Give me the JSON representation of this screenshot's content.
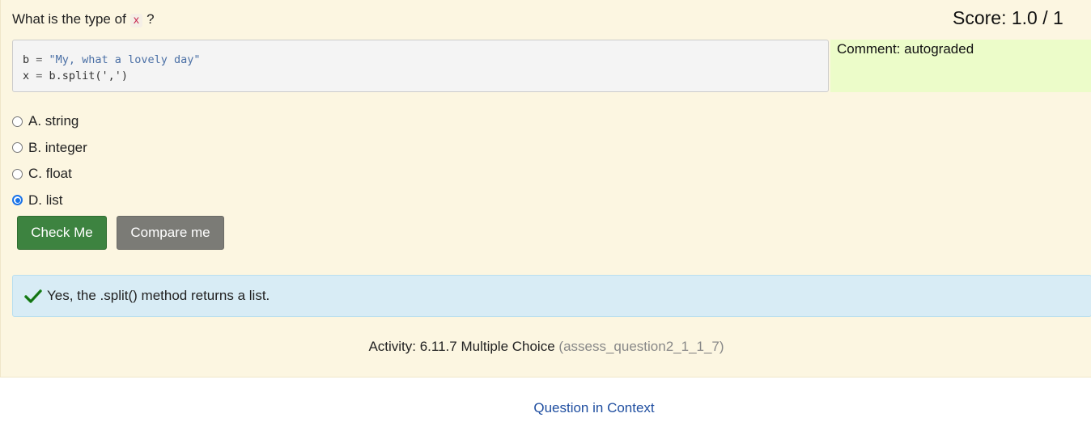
{
  "question": {
    "prefix": "What is the type of",
    "code_var": "x",
    "suffix": "?"
  },
  "score": "Score: 1.0 / 1",
  "code": {
    "line1_var": "b",
    "line1_op": " = ",
    "line1_str": "\"My, what a lovely day\"",
    "line2_var": "x",
    "line2_op": " = ",
    "line2_expr": "b.split(',')"
  },
  "comment": "Comment: autograded",
  "options": [
    {
      "label": "A. string",
      "selected": false
    },
    {
      "label": "B. integer",
      "selected": false
    },
    {
      "label": "C. float",
      "selected": false
    },
    {
      "label": "D. list",
      "selected": true
    }
  ],
  "buttons": {
    "check": "Check Me",
    "compare": "Compare me"
  },
  "feedback": {
    "icon": "checkmark-icon",
    "text": "Yes, the .split() method returns a list."
  },
  "activity": {
    "label": "Activity: 6.11.7 Multiple Choice",
    "id": "(assess_question2_1_1_7)"
  },
  "context_link": "Question in Context",
  "colors": {
    "panel_bg": "#fcf6e1",
    "comment_bg": "#ecfcc9",
    "check_button": "#3d8340",
    "compare_button": "#7b7b76",
    "feedback_bg": "#d8ecf5",
    "link": "#1f4ea0",
    "radio_selected": "#1a73e8"
  }
}
